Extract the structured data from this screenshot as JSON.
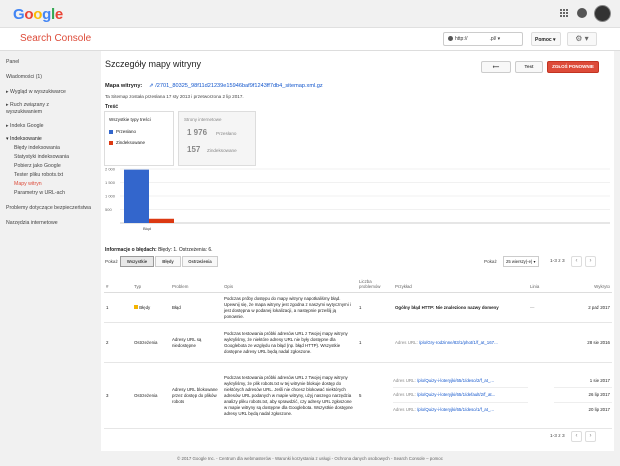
{
  "header": {
    "logo_letters": [
      "G",
      "o",
      "o",
      "g",
      "l",
      "e"
    ]
  },
  "console": {
    "title": "Search Console",
    "site_value": "http://",
    "site_suffix": ".pl/",
    "help_label": "Pomoc",
    "settings_icon": "gear-icon"
  },
  "sidebar": {
    "items": [
      {
        "label": "Panel"
      },
      {
        "label": "Wiadomości (1)"
      },
      {
        "label": "▸ Wygląd w wyszukiwarce"
      },
      {
        "label": "▸ Ruch związany z"
      },
      {
        "label": "   wyszukiwaniem"
      },
      {
        "label": "▸ Indeks Google"
      },
      {
        "label": "▾ Indeksowanie"
      },
      {
        "label": "Błędy indeksowania"
      },
      {
        "label": "Statystyki indeksowania"
      },
      {
        "label": "Pobierz jako Google"
      },
      {
        "label": "Tester pliku robots.txt"
      },
      {
        "label": "Mapy witryn"
      },
      {
        "label": "Parametry w URL-ach"
      },
      {
        "label": "Problemy dotyczące bezpieczeństwa"
      },
      {
        "label": "Narzędzia internetowe"
      }
    ]
  },
  "page": {
    "title": "Szczegóły mapy witryny",
    "back_label": "⟵",
    "test_label": "Test",
    "resubmit_label": "ZGŁOŚ PONOWNIE",
    "map_label": "Mapa witryny:",
    "map_url": "/2701_80325_98f11d21239e15946baf9f1243ff7db4_sitemap.xml.gz",
    "info": "Ta Sitemap została przesłana 17 sty 2013 i przetworzona 2 lip 2017.",
    "content_label": "Treść",
    "types_header": "Wszystkie typy treści",
    "legend_submitted": "Przesłano",
    "legend_indexed": "Zindeksowane",
    "stats_header": "Strony internetowe",
    "submitted_count": "1 976",
    "submitted_label": "Przesłano",
    "indexed_count": "157",
    "indexed_label": "Zindeksowane"
  },
  "chart_data": {
    "type": "bar",
    "categories": [
      "Błąd"
    ],
    "series": [
      {
        "name": "Przesłano",
        "values": [
          1976
        ],
        "color": "#3366cc"
      },
      {
        "name": "Zindeksowane",
        "values": [
          157
        ],
        "color": "#dc3912"
      }
    ],
    "ylim": [
      0,
      2000
    ],
    "yticks": [
      "2 000",
      "1 500",
      "1 000",
      "500"
    ],
    "grid": true
  },
  "errors": {
    "title": "Informacje o błędach:",
    "summary": " Błędy: 1. Ostrzeżenia: 6.",
    "show_label": "Pokaż",
    "tabs": [
      "Wszystkie",
      "Błędy",
      "Ostrzeżenia"
    ],
    "rows_label": "Pokaż",
    "rows_value": "25 wierszy(-e)",
    "pager": "1-3 z 3"
  },
  "table": {
    "columns": [
      "#",
      "Typ",
      "Problem",
      "Opis",
      "Liczba problemów",
      "Przykład",
      "Linia",
      "Wykryto"
    ],
    "rows": [
      {
        "num": "1",
        "type": "Błędy",
        "problem": "Błąd",
        "desc": "Podczas próby dostępu do mapy witryny napotkaliśmy błąd. Upewnij się, że mapa witryny jest zgodna z naszymi wytycznymi i jest dostępna w podanej lokalizacji, a następnie prześlij ją ponownie.",
        "count": "1",
        "example": "Ogólny błąd HTTP: Nie znaleziono nazwy domeny",
        "line": "—",
        "date": "2 paź 2017"
      },
      {
        "num": "2",
        "type": "Ostrzeżenia",
        "problem": "Adresy URL są niedostępne",
        "desc": "Podczas testowania próbki adresów URL z Twojej mapy witryny wykryliśmy, że niektóre adresy URL nie były dostępne dla Googlebota ze względu na błąd (np. błąd HTTP). Wszystkie dostępne adresy URL będą nadal zgłoszone.",
        "count": "1",
        "example_prefix": "Adres URL:",
        "example_link": "/plo/Gry-rodzinne/83/1/phot/1/f_at_167...",
        "date": "28 sie 2016"
      },
      {
        "num": "3",
        "type": "Ostrzeżenia",
        "problem": "Adresy URL blokowane przez dostęp do plików robots",
        "desc": "Podczas testowania próbki adresów URL z Twojej mapy witryny wykryliśmy, że plik robots.txt w tej witrynie blokuje dostęp do niektórych adresów URL. Jeśli nie chcesz blokować niektórych adresów URL podanych w mapie witryny, użyj naszego narzędzia analizy pliku robots.txt, aby sprawdzić, czy adresy URL zgłoszone w mapie witryny są dostępne dla Googlebota. Wszystkie dostępne adresy URL będą nadal zgłoszone.",
        "count": "5",
        "sub": [
          {
            "prefix": "Adres URL:",
            "link": "/plo/Quizy-i-loteryjki/65/1/deso/2/f_at_...",
            "date": "1 sie 2017"
          },
          {
            "prefix": "Adres URL:",
            "link": "/plo/Quizy-i-loteryjki/65/1/default/2/f_at...",
            "date": "26 lip 2017"
          },
          {
            "prefix": "Adres URL:",
            "link": "/plo/Quizy-i-loteryjki/65/1/deso/1/f_at_...",
            "date": "20 lip 2017"
          }
        ]
      }
    ]
  },
  "footer": "© 2017 Google Inc. - Centrum dla webmasterów - Warunki korzystania z usługi - Ochrona danych osobowych - Search Console – pomoc"
}
